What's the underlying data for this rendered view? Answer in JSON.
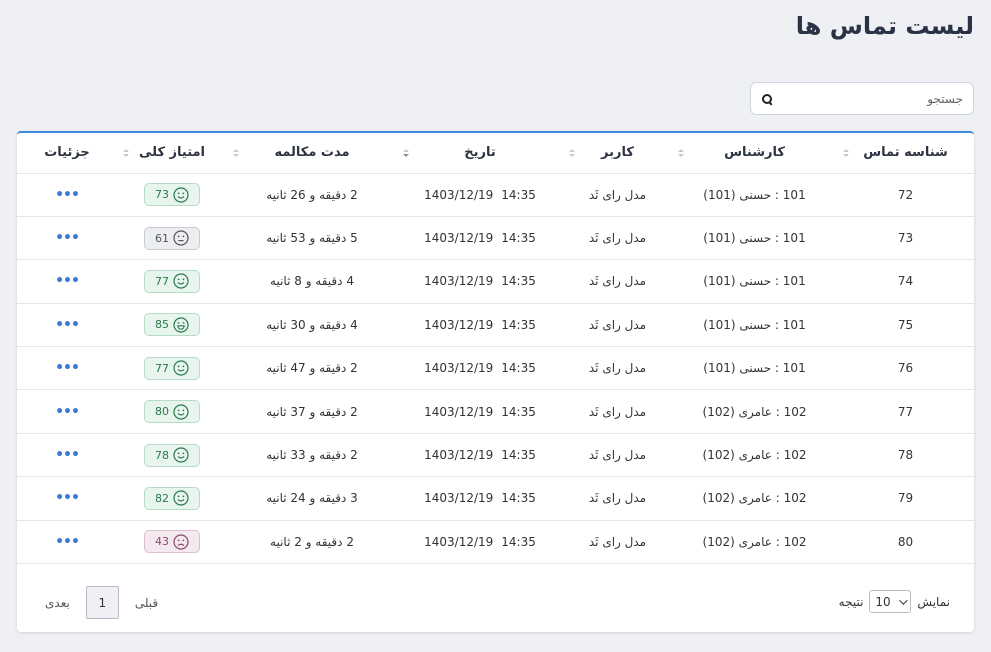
{
  "page": {
    "title": "لیست تماس ها"
  },
  "search": {
    "placeholder": "جستجو",
    "value": ""
  },
  "table": {
    "headers": [
      "شناسه تماس",
      "کارشناس",
      "کاربر",
      "تاریخ",
      "مدت مکالمه",
      "امتیاز کلی",
      "جزئیات"
    ],
    "rows": [
      {
        "id": "72",
        "agent": "101 : حسنی (101)",
        "user": "مدل رای ثَد",
        "date": "1403/12/19",
        "time": "14:35",
        "duration": "2 دقیقه و 26 ثانیه",
        "score": "73",
        "mood": "good",
        "face": "smile"
      },
      {
        "id": "73",
        "agent": "101 : حسنی (101)",
        "user": "مدل رای ثَد",
        "date": "1403/12/19",
        "time": "14:35",
        "duration": "5 دقیقه و 53 ثانیه",
        "score": "61",
        "mood": "neutral",
        "face": "neutral"
      },
      {
        "id": "74",
        "agent": "101 : حسنی (101)",
        "user": "مدل رای ثَد",
        "date": "1403/12/19",
        "time": "14:35",
        "duration": "4 دقیقه و 8 ثانیه",
        "score": "77",
        "mood": "good",
        "face": "smile"
      },
      {
        "id": "75",
        "agent": "101 : حسنی (101)",
        "user": "مدل رای ثَد",
        "date": "1403/12/19",
        "time": "14:35",
        "duration": "4 دقیقه و 30 ثانیه",
        "score": "85",
        "mood": "good",
        "face": "laugh"
      },
      {
        "id": "76",
        "agent": "101 : حسنی (101)",
        "user": "مدل رای ثَد",
        "date": "1403/12/19",
        "time": "14:35",
        "duration": "2 دقیقه و 47 ثانیه",
        "score": "77",
        "mood": "good",
        "face": "smile"
      },
      {
        "id": "77",
        "agent": "102 : عامری (102)",
        "user": "مدل رای ثَد",
        "date": "1403/12/19",
        "time": "14:35",
        "duration": "2 دقیقه و 37 ثانیه",
        "score": "80",
        "mood": "good",
        "face": "smile"
      },
      {
        "id": "78",
        "agent": "102 : عامری (102)",
        "user": "مدل رای ثَد",
        "date": "1403/12/19",
        "time": "14:35",
        "duration": "2 دقیقه و 33 ثانیه",
        "score": "78",
        "mood": "good",
        "face": "smile"
      },
      {
        "id": "79",
        "agent": "102 : عامری (102)",
        "user": "مدل رای ثَد",
        "date": "1403/12/19",
        "time": "14:35",
        "duration": "3 دقیقه و 24 ثانیه",
        "score": "82",
        "mood": "good",
        "face": "smile"
      },
      {
        "id": "80",
        "agent": "102 : عامری (102)",
        "user": "مدل رای ثَد",
        "date": "1403/12/19",
        "time": "14:35",
        "duration": "2 دقیقه و 2 ثانیه",
        "score": "43",
        "mood": "bad",
        "face": "sad"
      }
    ],
    "details_icon": "•••"
  },
  "pagination": {
    "prev_label": "قبلی",
    "next_label": "بعدی",
    "current_page": "1"
  },
  "page_size": {
    "show_label": "نمایش",
    "value": "10",
    "results_label": "نتیجه"
  },
  "colors": {
    "accent": "#3f8ae0",
    "good": "#2b7a4b",
    "neutral": "#555555",
    "bad": "#8a4a68"
  },
  "icons": {
    "search": "search-icon",
    "sort": "sort-icon",
    "details": "more-dots-icon",
    "dropdown": "chevron-down-icon"
  }
}
